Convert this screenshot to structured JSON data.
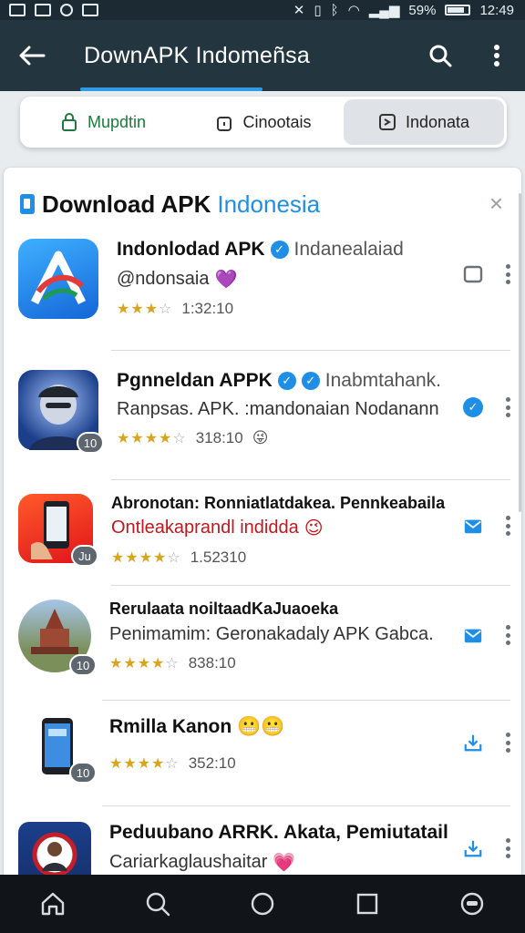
{
  "status_bar": {
    "battery": "59%",
    "time": "12:49"
  },
  "app_bar": {
    "title": "DownAPK Indomeñsa"
  },
  "tabs": [
    {
      "label": "Mupdtin",
      "icon": "lock-icon"
    },
    {
      "label": "Cinootais",
      "icon": "lock-icon"
    },
    {
      "label": "Indonata",
      "icon": "arrow-box-icon"
    }
  ],
  "card": {
    "title_main": "Download APK",
    "title_accent": "Indonesia",
    "close": "×"
  },
  "apps": [
    {
      "title": "Indonlodad APK",
      "title_extra": "Indanealaiad",
      "subtitle": "@ndonsaia",
      "subtitle_emoji": "💜",
      "rating": 3,
      "meta": "1:32:10",
      "action_icon": "square-icon",
      "badge": ""
    },
    {
      "title": "Pgnneldan APPK",
      "title_extra": "Inabmtahank.",
      "subtitle": "Ranpsas. APK. :mandonaian Nodanann",
      "subtitle_emoji": "",
      "rating": 4,
      "meta": "318:10",
      "meta_emoji": "😜",
      "action_icon": "verified-icon",
      "badge": "10"
    },
    {
      "title": "Abronotan: Ronniatlatdakea. Pennkeabaila",
      "subtitle": "Ontleakaprandl indidda",
      "subtitle_emoji": "😉",
      "rating": 4,
      "meta": "1.52310",
      "action_icon": "mail-icon",
      "badge": "Ju"
    },
    {
      "title": "Rerulaata noiltaadKaJuaoeka",
      "subtitle": "Penimamim: Geronakadaly APK Gabca.",
      "rating": 4,
      "meta": "838:10",
      "action_icon": "mail-icon",
      "badge": "10"
    },
    {
      "title": "Rmilla Kanon",
      "title_emoji": "😬😬",
      "rating": 4,
      "meta": "352:10",
      "action_icon": "download-icon",
      "badge": "10"
    },
    {
      "title": "Peduubano ARRK. Akata, Pemiutatail",
      "subtitle": "Cariarkaglaushaitar",
      "subtitle_emoji": "💗",
      "action_icon": "download-icon"
    }
  ],
  "colors": {
    "appbar": "#233640",
    "accent": "#1f8fe6",
    "star": "#d9a51f"
  }
}
